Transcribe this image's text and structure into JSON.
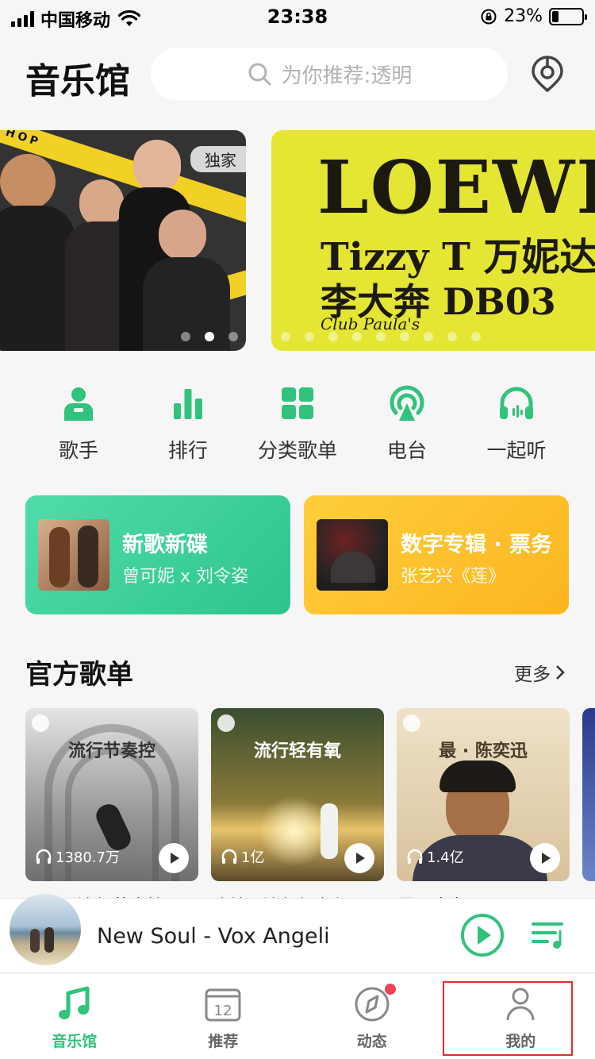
{
  "status_bar": {
    "carrier": "中国移动",
    "time": "23:38",
    "battery": "23%",
    "battery_level": 0.23
  },
  "header": {
    "title": "音乐馆",
    "search_placeholder": "为你推荐:透明"
  },
  "banners": {
    "left": {
      "badge": "独家",
      "tape_text": "HIPHOP"
    },
    "right": {
      "line1": "LOEWE",
      "line2": "Tizzy T 万妮达",
      "line3": "李大奔 DB03",
      "line4": "Club Paula's"
    }
  },
  "categories": [
    {
      "label": "歌手",
      "icon": "singer-icon"
    },
    {
      "label": "排行",
      "icon": "chart-icon"
    },
    {
      "label": "分类歌单",
      "icon": "grid-icon"
    },
    {
      "label": "电台",
      "icon": "radio-icon"
    },
    {
      "label": "一起听",
      "icon": "headphones-icon"
    }
  ],
  "promos": [
    {
      "title": "新歌新碟",
      "subtitle": "曾可妮 x 刘令姿"
    },
    {
      "title": "数字专辑 · 票务",
      "subtitle": "张艺兴《莲》"
    }
  ],
  "section": {
    "title": "官方歌单",
    "more": "更多"
  },
  "playlists": [
    {
      "title": "流行节奏控",
      "count": "1380.7万",
      "caption": "电音 | 流行节奏控"
    },
    {
      "title": "流行轻有氧",
      "count": "1亿",
      "caption": "欧美 | 流行轻有氧"
    },
    {
      "title": "最 · 陈奕迅",
      "count": "1.4亿",
      "caption": "最 · 陈奕迅"
    }
  ],
  "player": {
    "title": "New Soul - Vox Angeli"
  },
  "tabs": [
    {
      "label": "音乐馆",
      "icon": "music-note-icon",
      "active": true
    },
    {
      "label": "推荐",
      "icon": "calendar-icon",
      "date": "12"
    },
    {
      "label": "动态",
      "icon": "compass-icon"
    },
    {
      "label": "我的",
      "icon": "person-icon"
    }
  ],
  "colors": {
    "accent": "#31c27c",
    "badge": "#f0435b",
    "highlight": "#e62b2b"
  }
}
